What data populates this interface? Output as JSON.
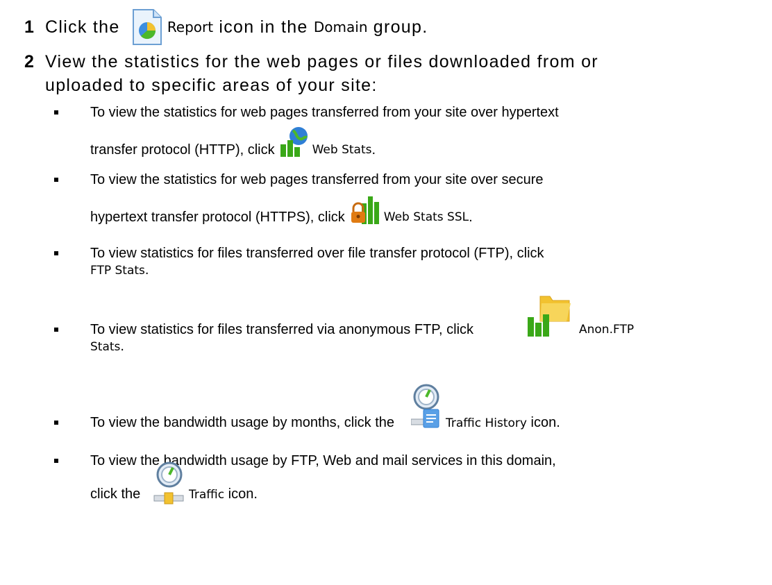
{
  "step1": {
    "number": "1",
    "text_before": "Click the",
    "icon_label": "Report",
    "text_mid": "icon in the",
    "group_name": "Domain",
    "text_after": "group."
  },
  "step2": {
    "number": "2",
    "line1": "View the statistics for the web pages or files downloaded from or",
    "line2": "uploaded to specific areas of your site:"
  },
  "bullets": [
    {
      "line1": "To view the statistics for web pages transferred from your site over hypertext",
      "line2": "transfer protocol (HTTP), click",
      "label": "Web Stats",
      "suffix": ".",
      "icon": "web-stats-icon"
    },
    {
      "line1": "To view the statistics for web pages transferred from your site over secure",
      "line2": "hypertext transfer protocol (HTTPS), click",
      "label": "Web Stats SSL",
      "suffix": ".",
      "icon": "web-stats-ssl-icon"
    },
    {
      "line1": "To view statistics for files transferred over file transfer protocol (FTP), click",
      "label": "FTP Stats",
      "suffix": ".",
      "icon": "ftp-stats-icon"
    },
    {
      "line1": "To view statistics for files transferred via anonymous FTP, click",
      "label_part1": "Anon.FTP",
      "label_part2": "Stats",
      "suffix": ".",
      "icon": "anon-ftp-stats-icon"
    },
    {
      "line1": "To view the bandwidth usage by months, click the",
      "label": "Traffic History",
      "suffix": "icon.",
      "icon": "traffic-history-icon"
    },
    {
      "line1": "To view the bandwidth usage by FTP, Web and mail services in this domain,",
      "line2": "click the",
      "label": "Traffic",
      "suffix": "icon.",
      "icon": "traffic-icon"
    }
  ],
  "colors": {
    "bar_green": "#3aa818",
    "globe_blue": "#2f7fd6",
    "folder_yellow": "#f2c230",
    "lock_orange": "#e07b12"
  }
}
